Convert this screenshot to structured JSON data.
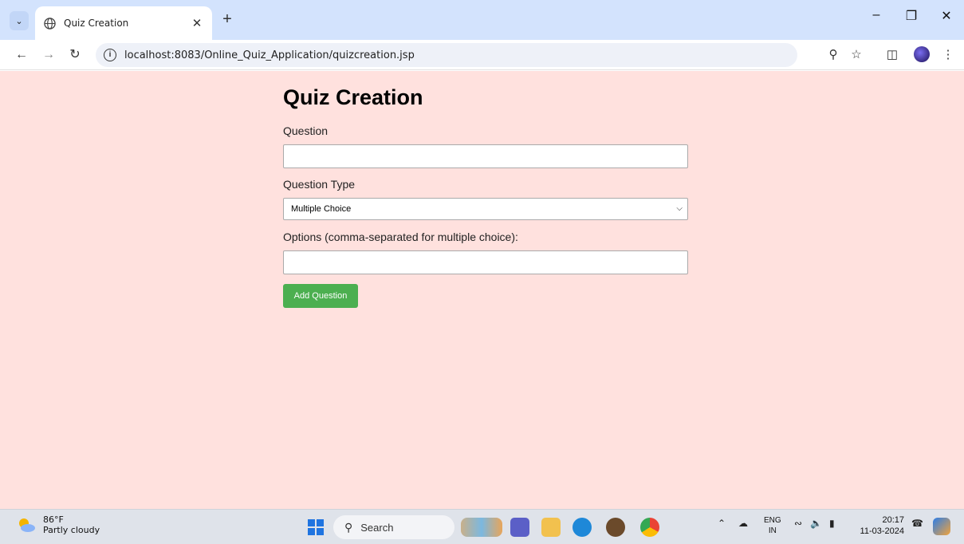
{
  "browser": {
    "tab_title": "Quiz Creation",
    "url": "localhost:8083/Online_Quiz_Application/quizcreation.jsp"
  },
  "page": {
    "title": "Quiz Creation",
    "question_label": "Question",
    "question_value": "",
    "type_label": "Question Type",
    "type_selected": "Multiple Choice",
    "options_label": "Options (comma-separated for multiple choice):",
    "options_value": "",
    "add_button": "Add Question",
    "background_color": "#ffe1de",
    "button_color": "#4caf50"
  },
  "taskbar": {
    "weather_temp": "86°F",
    "weather_desc": "Partly cloudy",
    "search_placeholder": "Search",
    "lang_top": "ENG",
    "lang_bottom": "IN",
    "time": "20:17",
    "date": "11-03-2024"
  }
}
